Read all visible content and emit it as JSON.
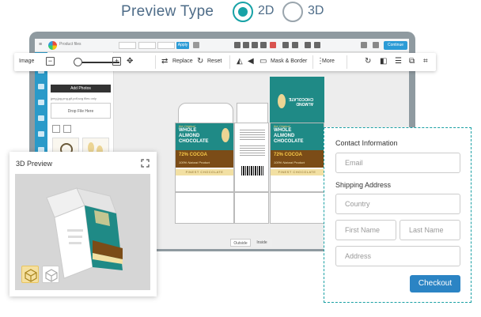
{
  "preview_type": {
    "title": "Preview Type",
    "options": [
      {
        "label": "2D",
        "selected": true
      },
      {
        "label": "3D",
        "selected": false
      }
    ]
  },
  "editor": {
    "product_label": "Product files",
    "apply_label": "Apply",
    "continue_label": "Continue",
    "add_photos": "Add Photos",
    "file_note": "jpeg,jpg,png,gif,pdf,svg files only",
    "drop_file": "Drop File Here",
    "view_tabs": [
      "Outside",
      "Inside"
    ]
  },
  "image_toolbar": {
    "label": "Image",
    "replace": "Replace",
    "reset": "Reset",
    "mask_border": "Mask & Border",
    "more": "More"
  },
  "package_art": {
    "tagline": "the Original",
    "name_line1": "WHOLE",
    "name_line2": "ALMOND",
    "name_line3": "CHOCOLATE",
    "cocoa": "72% COCOA",
    "natural": "100% Natural Product",
    "finest": "FINEST CHOCOLATE"
  },
  "preview_3d": {
    "title": "3D Preview"
  },
  "checkout": {
    "contact_heading": "Contact Information",
    "email_placeholder": "Email",
    "shipping_heading": "Shipping Address",
    "country_placeholder": "Country",
    "first_name_placeholder": "First Name",
    "last_name_placeholder": "Last Name",
    "address_placeholder": "Address",
    "checkout_label": "Checkout"
  },
  "colors": {
    "accent": "#17a2a6",
    "brand_teal": "#1f8a86",
    "chocolate": "#7b4c17",
    "button_blue": "#2b84c4"
  }
}
